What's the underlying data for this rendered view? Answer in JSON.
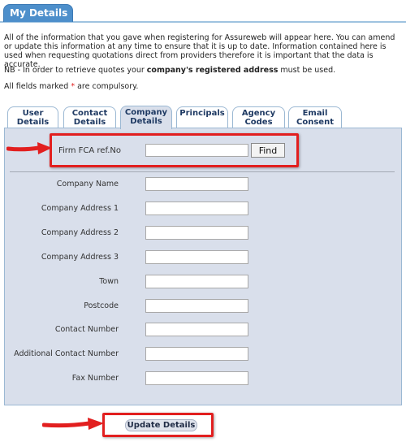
{
  "header": {
    "title": "My Details"
  },
  "intro": {
    "text": "All of the information that you gave when registering for Assureweb will appear here. You can amend or update this information at any time to ensure that it is up to date. Information contained here is used when requesting quotations direct from providers therefore it is important that the data is accurate.",
    "nb_prefix": "NB - In order to retrieve quotes your ",
    "nb_bold": "company's registered address",
    "nb_suffix": " must be used.",
    "compulsory_prefix": "All fields marked ",
    "compulsory_star": "*",
    "compulsory_suffix": " are compulsory."
  },
  "tabs": [
    {
      "line1": "User",
      "line2": "Details"
    },
    {
      "line1": "Contact",
      "line2": "Details"
    },
    {
      "line1": "Company",
      "line2": "Details"
    },
    {
      "line1": "Principals",
      "line2": ""
    },
    {
      "line1": "Agency",
      "line2": "Codes"
    },
    {
      "line1": "Email",
      "line2": "Consent"
    }
  ],
  "active_tab": "Company Details",
  "fca": {
    "label": "Firm FCA ref.No",
    "value": "",
    "find_label": "Find"
  },
  "fields": [
    {
      "label": "Company Name",
      "value": ""
    },
    {
      "label": "Company Address 1",
      "value": ""
    },
    {
      "label": "Company Address 2",
      "value": ""
    },
    {
      "label": "Company Address 3",
      "value": ""
    },
    {
      "label": "Town",
      "value": ""
    },
    {
      "label": "Postcode",
      "value": ""
    },
    {
      "label": "Contact Number",
      "value": ""
    },
    {
      "label": "Additional Contact Number",
      "value": ""
    },
    {
      "label": "Fax Number",
      "value": ""
    }
  ],
  "update_label": "Update Details",
  "colors": {
    "header_blue": "#4d8fcb",
    "panel": "#d9dfeb",
    "highlight_red": "#e21f1f"
  }
}
